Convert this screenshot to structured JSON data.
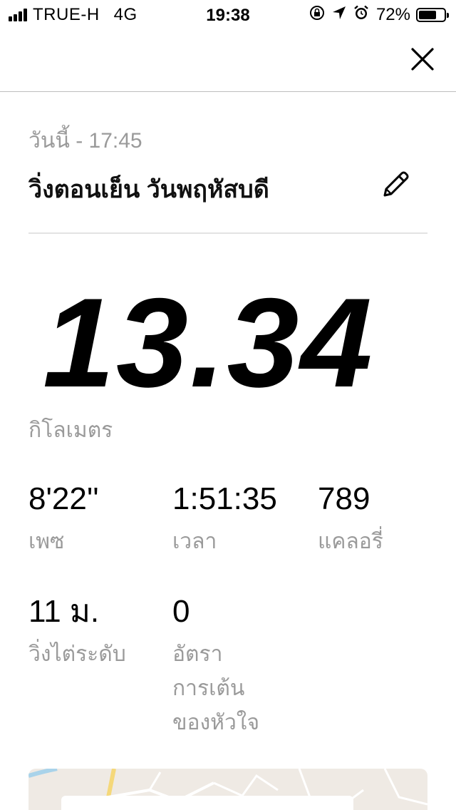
{
  "status_bar": {
    "carrier": "TRUE-H",
    "network": "4G",
    "time": "19:38",
    "battery_percent": "72%",
    "battery_level": 0.72,
    "icons": [
      "signal-icon",
      "rotation-lock-icon",
      "location-arrow-icon",
      "alarm-clock-icon",
      "battery-icon"
    ]
  },
  "nav": {
    "close_icon": "close-icon"
  },
  "header": {
    "date": "วันนี้ - 17:45",
    "title": "วิ่งตอนเย็น วันพฤหัสบดี",
    "edit_icon": "pencil-icon"
  },
  "distance": {
    "value": "13.34",
    "unit": "กิโลเมตร"
  },
  "stats": [
    {
      "value": "8'22''",
      "label_lines": [
        "เพซ"
      ]
    },
    {
      "value": "1:51:35",
      "label_lines": [
        "เวลา"
      ]
    },
    {
      "value": "789",
      "label_lines": [
        "แคลอรี่"
      ]
    },
    {
      "value": "11 ม.",
      "label_lines": [
        "วิ่งไต่ระดับ"
      ]
    },
    {
      "value": "0",
      "label_lines": [
        "อัตรา",
        "การเต้น",
        "ของหัวใจ"
      ]
    }
  ],
  "colors": {
    "background": "#ffffff",
    "text_primary": "#000000",
    "text_secondary": "#9a9a9a",
    "divider": "#e3e3e3",
    "map_background": "#efeae4"
  }
}
